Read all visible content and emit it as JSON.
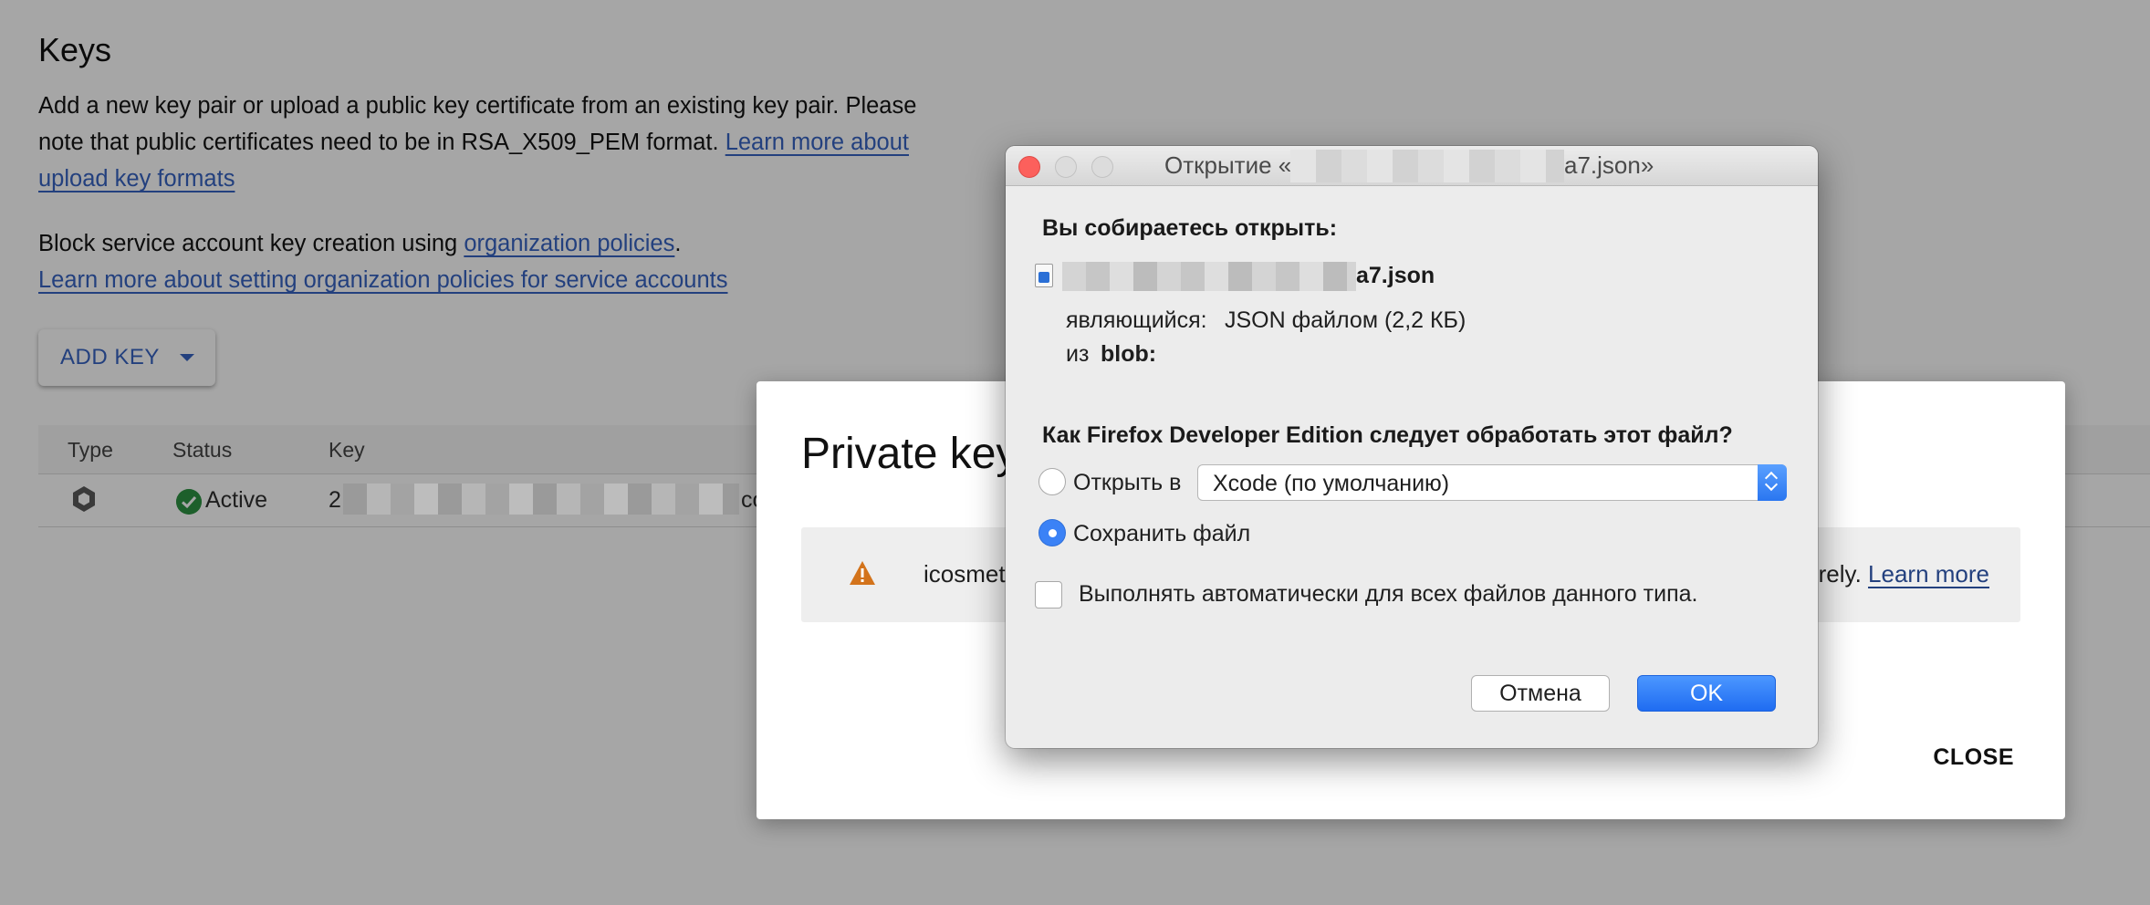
{
  "page": {
    "title": "Keys",
    "para1_text": "Add a new key pair or upload a public key certificate from an existing key pair. Please note that public certificates need to be in RSA_X509_PEM format. ",
    "para1_link": "Learn more about upload key formats",
    "para2_text": "Block service account key creation using ",
    "para2_link": "organization policies",
    "para2_period": ".",
    "para2_link2": "Learn more about setting organization policies for service accounts",
    "add_key_label": "ADD KEY"
  },
  "table": {
    "columns": [
      "Type",
      "Status",
      "Key"
    ],
    "rows": [
      {
        "status": "Active",
        "key_prefix": "2",
        "key_suffix": "co"
      }
    ]
  },
  "private_key_dialog": {
    "title": "Private key",
    "warning_text": "icosmet",
    "warning_tail": "urely.",
    "learn_more": "Learn more",
    "close_label": "CLOSE"
  },
  "ff_dialog": {
    "title_prefix": "Открытие «",
    "title_suffix": "a7.json»",
    "heading_open": "Вы собираетесь открыть:",
    "file_suffix": "a7.json",
    "type_label": "являющийся:",
    "type_value": "JSON файлом (2,2 КБ)",
    "from_label": "из",
    "from_value": "blob:",
    "question": "Как Firefox Developer Edition следует обработать этот файл?",
    "open_with_label": "Открыть в",
    "open_with_app": "Xcode (по умолчанию)",
    "save_file_label": "Сохранить файл",
    "auto_label": "Выполнять автоматически для всех файлов данного типа.",
    "cancel_label": "Отмена",
    "ok_label": "OK"
  },
  "colors": {
    "link": "#23407e",
    "ok_button": "#2a76f0",
    "warning": "#d3731b",
    "active": "#1d5f2b",
    "close_light": "#fc605c"
  },
  "icons": [
    "type-icon",
    "status-check-icon",
    "warning-icon",
    "file-json-icon",
    "chevron-down-icon",
    "stepper-icon"
  ]
}
